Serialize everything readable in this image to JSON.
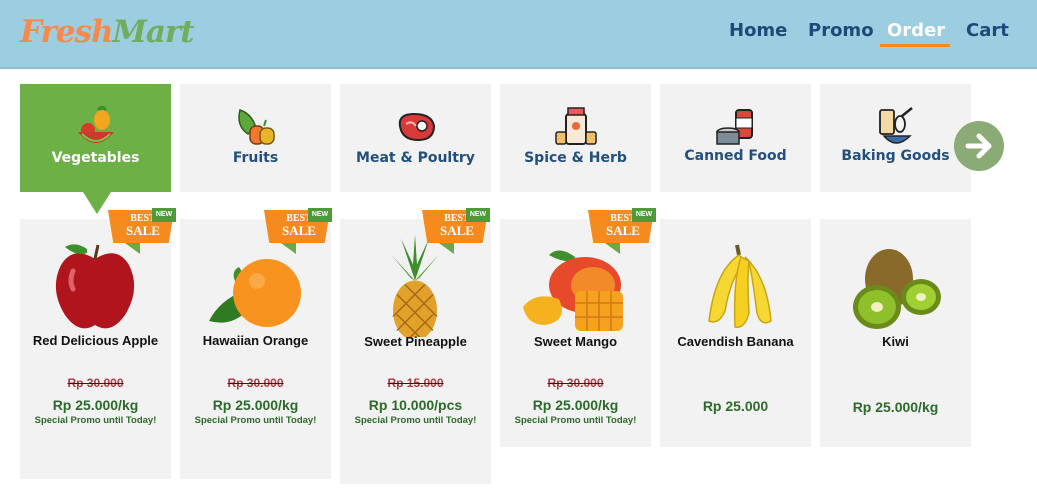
{
  "header": {
    "logo_part1": "Fresh",
    "logo_part2": "Mart",
    "nav": [
      "Home",
      "Promo",
      "Order",
      "Cart"
    ],
    "active_nav": "Order"
  },
  "categories": [
    {
      "label": "Vegetables",
      "icon": "fruit-basket-icon",
      "active": true
    },
    {
      "label": "Fruits",
      "icon": "vegetables-icon",
      "active": false
    },
    {
      "label": "Meat & Poultry",
      "icon": "steak-icon",
      "active": false
    },
    {
      "label": "Spice & Herb",
      "icon": "spice-jar-icon",
      "active": false
    },
    {
      "label": "Canned Food",
      "icon": "canned-food-icon",
      "active": false
    },
    {
      "label": "Baking Goods",
      "icon": "baking-icon",
      "active": false
    }
  ],
  "badge": {
    "best": "BEST",
    "sale": "SALE",
    "new": "NEW"
  },
  "products": [
    {
      "name": "Red Delicious Apple",
      "old_price": "Rp 30.000",
      "price": "Rp 25.000/kg",
      "promo": "Special Promo until Today!",
      "best_sale": true
    },
    {
      "name": "Hawaiian Orange",
      "old_price": "Rp 30.000",
      "price": "Rp 25.000/kg",
      "promo": "Special Promo until Today!",
      "best_sale": true
    },
    {
      "name": "Sweet Pineapple",
      "old_price": "Rp 15.000",
      "price": "Rp 10.000/pcs",
      "promo": "Special Promo until Today!",
      "best_sale": true
    },
    {
      "name": "Sweet Mango",
      "old_price": "Rp 30.000",
      "price": "Rp 25.000/kg",
      "promo": "Special Promo until Today!",
      "best_sale": true
    },
    {
      "name": "Cavendish Banana",
      "old_price": "",
      "price": "Rp 25.000",
      "promo": "",
      "best_sale": false
    },
    {
      "name": "Kiwi",
      "old_price": "",
      "price": "Rp 25.000/kg",
      "promo": "",
      "best_sale": false
    }
  ],
  "colors": {
    "header_bg": "#9ccde0",
    "nav_text": "#1e4a7a",
    "active_category": "#6db045",
    "badge_orange": "#f58a1f",
    "price_green": "#2e6a2b"
  }
}
